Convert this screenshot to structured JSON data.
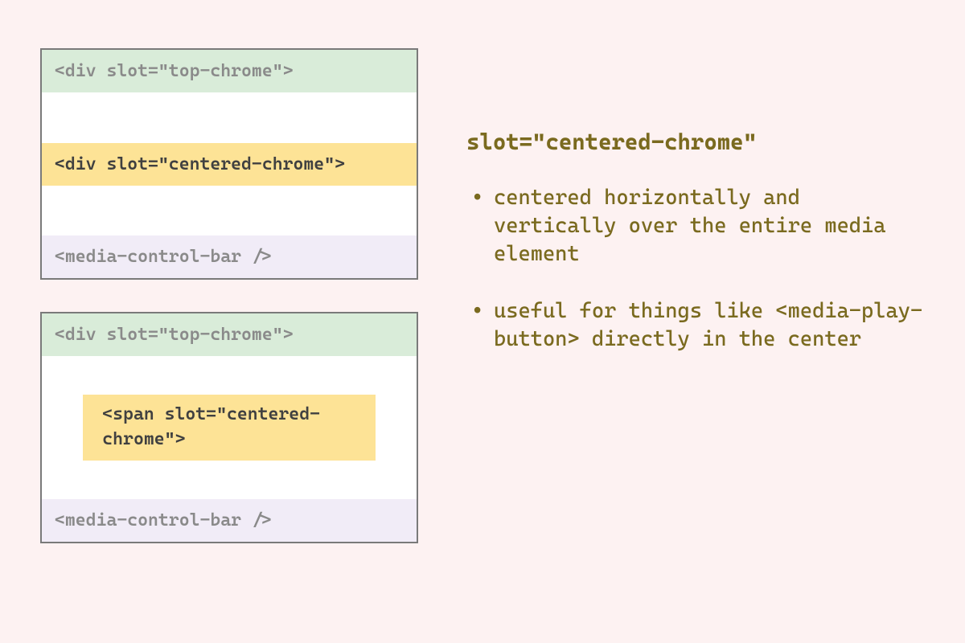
{
  "diagram1": {
    "top": "<div slot=\"top-chrome\">",
    "centered": "<div slot=\"centered-chrome\">",
    "bottom": "<media-control-bar />"
  },
  "diagram2": {
    "top": "<div slot=\"top-chrome\">",
    "centered": " <span slot=\"centered-chrome\">",
    "bottom": "<media-control-bar />"
  },
  "text": {
    "heading": "slot=\"centered-chrome\"",
    "bullet1": "centered horizontally and vertically over the entire media element",
    "bullet2": "useful for things like <media-play-button> directly in the center"
  }
}
